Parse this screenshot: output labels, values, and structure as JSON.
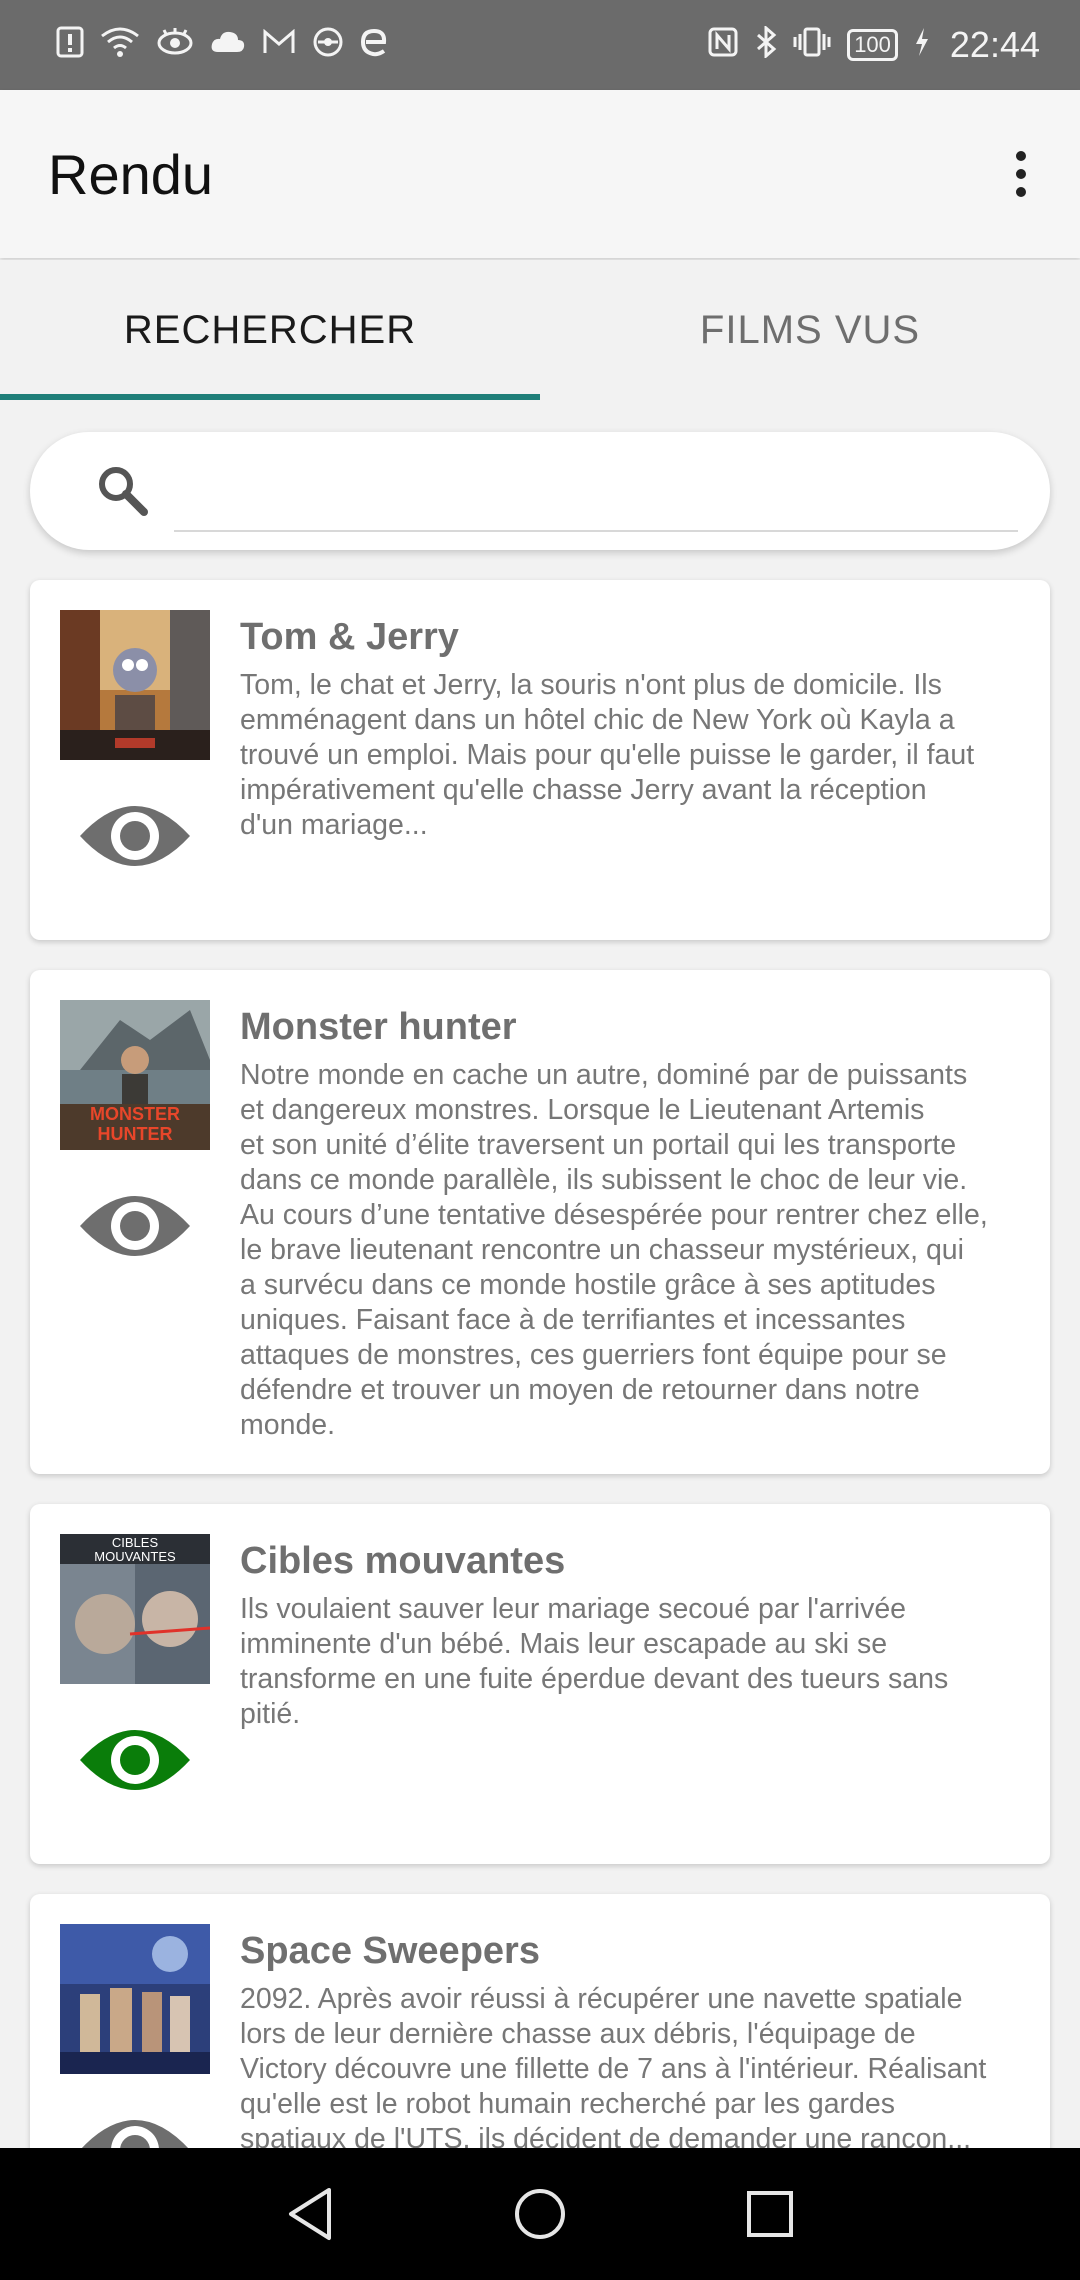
{
  "status_bar": {
    "left_icons": [
      "alert-icon",
      "wifi-icon",
      "eye-icon",
      "cloud-icon",
      "gmail-icon",
      "app-icon",
      "e-icon"
    ],
    "nfc": "N",
    "battery": "100",
    "time": "22:44"
  },
  "app_bar": {
    "title": "Rendu"
  },
  "tabs": [
    {
      "label": "RECHERCHER",
      "active": true
    },
    {
      "label": "FILMS VUS",
      "active": false
    }
  ],
  "search": {
    "value": "",
    "placeholder": ""
  },
  "movies": [
    {
      "title": "Tom & Jerry",
      "description": "Tom, le chat et Jerry, la souris n'ont plus de domicile. Ils\nemménagent dans un hôtel chic de New York où Kayla a\ntrouvé un emploi. Mais pour qu'elle puisse le garder, il faut\nimpérativement qu'elle chasse Jerry avant la réception\nd'un mariage...",
      "seen": false,
      "eye_color": "#6e6e6e"
    },
    {
      "title": "Monster hunter",
      "description": "Notre monde en cache un autre, dominé par de puissants\net dangereux monstres. Lorsque le Lieutenant Artemis\net son unité d’élite traversent un portail qui les transporte\ndans ce monde parallèle, ils subissent le choc de leur vie.\nAu cours d’une tentative désespérée pour rentrer chez elle,\nle brave lieutenant rencontre un chasseur mystérieux, qui\na survécu dans ce monde hostile grâce à ses aptitudes\nuniques. Faisant face à de terrifiantes et incessantes\nattaques de monstres, ces guerriers font équipe pour se\ndéfendre et trouver un moyen de retourner dans notre\nmonde.",
      "seen": false,
      "eye_color": "#6e6e6e",
      "poster_text": "MONSTER HUNTER"
    },
    {
      "title": "Cibles mouvantes",
      "description": "Ils voulaient sauver leur mariage secoué par l'arrivée\nimminente d'un bébé. Mais leur escapade au ski se\ntransforme en une fuite éperdue devant des tueurs sans\npitié.",
      "seen": true,
      "eye_color": "#0a7d0a",
      "poster_text": "CIBLES MOUVANTES"
    },
    {
      "title": "Space Sweepers",
      "description": "2092. Après avoir réussi à récupérer une navette spatiale\nlors de leur dernière chasse aux débris, l'équipage de\nVictory découvre une fillette de 7 ans à l'intérieur. Réalisant\nqu'elle est le robot humain recherché par les gardes\nspatiaux de l'UTS, ils décident de demander une rançon...",
      "seen": false,
      "eye_color": "#6e6e6e"
    }
  ],
  "nav_bar": {
    "buttons": [
      "back-icon",
      "home-icon",
      "recents-icon"
    ]
  },
  "colors": {
    "accent": "#1f7f79",
    "seen": "#0a7d0a",
    "unseen": "#6e6e6e"
  }
}
